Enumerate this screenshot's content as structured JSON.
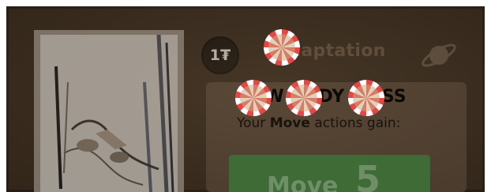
{
  "card": {
    "level": "1₮",
    "title": "Adaptation",
    "keyword": "LOW BODY MASS",
    "description_prefix": "Your ",
    "description_emphasis": "Move",
    "description_suffix": " actions gain:",
    "bonus_label": "Move",
    "bonus_value": "5"
  },
  "icons": {
    "planet": "planet-icon"
  },
  "colors": {
    "card_background": "#3b2d1f",
    "bonus_box": "#3e6b36",
    "marker_red": "#e84545"
  }
}
